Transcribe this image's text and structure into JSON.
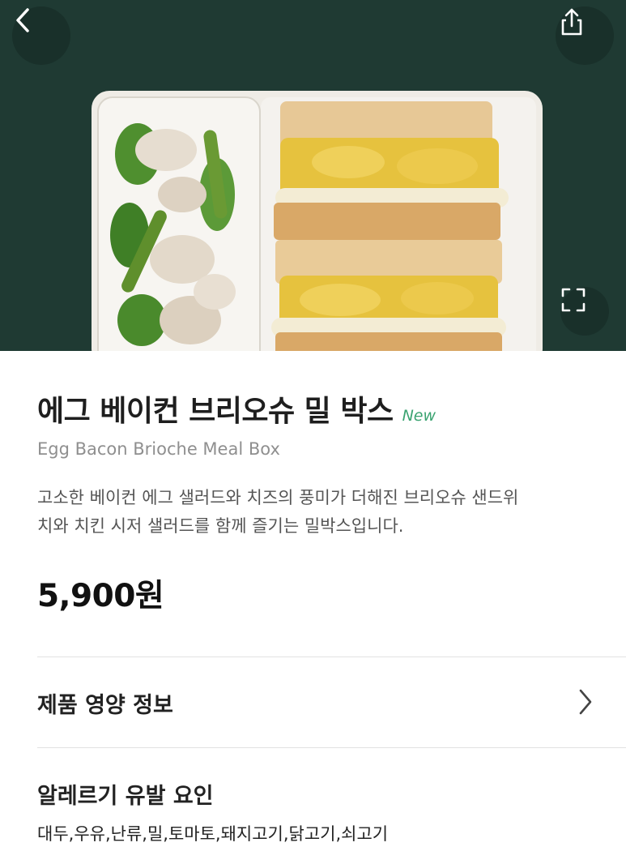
{
  "product": {
    "title": "에그 베이컨 브리오슈 밀 박스",
    "badge": "New",
    "subtitle": "Egg Bacon Brioche Meal Box",
    "description_line1": "고소한 베이컨 에그 샐러드와 치즈의 풍미가 더해진 브리오슈 샌드위",
    "description_line2": "치와 치킨 시저 샐러드를 함께 즐기는 밀박스입니다.",
    "price": "5,900원"
  },
  "sections": {
    "nutrition_label": "제품 영양 정보",
    "allergy_label": "알레르기 유발 요인",
    "allergy_list": "대두,우유,난류,밀,토마토,돼지고기,닭고기,쇠고기"
  },
  "icons": {
    "back": "chevron-left-icon",
    "share": "share-icon",
    "expand": "expand-icon",
    "nutrition_arrow": "chevron-right-icon"
  },
  "colors": {
    "hero_background": "#1f3a33",
    "new_badge": "#3aa370"
  }
}
